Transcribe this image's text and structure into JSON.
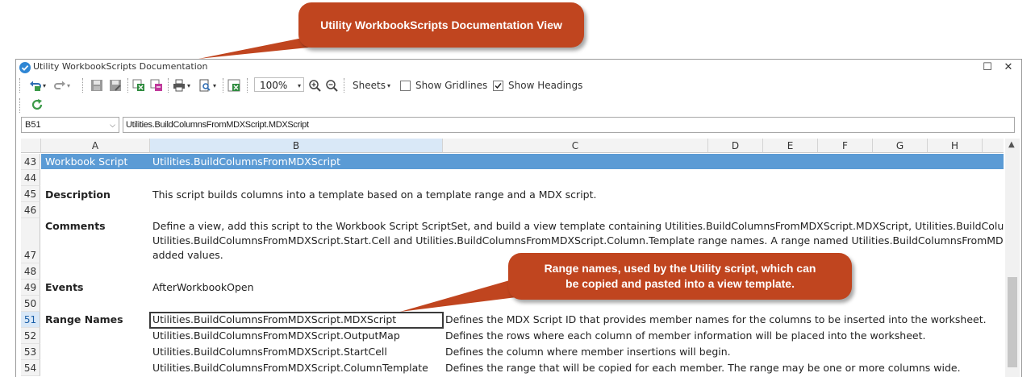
{
  "callouts": {
    "top": "Utility WorkbookScripts Documentation View",
    "range": "Range names, used by the Utility script, which can be copied and pasted into a view template."
  },
  "window": {
    "title": "Utility WorkbookScripts Documentation",
    "maximize": "☐",
    "close": "✕"
  },
  "toolbar": {
    "zoom": "100%",
    "sheets_label": "Sheets",
    "show_gridlines_label": "Show Gridlines",
    "show_gridlines_checked": false,
    "show_headings_label": "Show Headings",
    "show_headings_checked": true,
    "icons": [
      "undo-icon",
      "redo-icon",
      "save-icon",
      "save-as-icon",
      "export-excel-icon",
      "export-pdf-icon",
      "print-icon",
      "print-preview-icon",
      "excel-icon",
      "zoom-in-icon",
      "zoom-out-icon",
      "refresh-icon"
    ]
  },
  "formula_bar": {
    "name_box": "B51",
    "formula": "Utilities.BuildColumnsFromMDXScript.MDXScript"
  },
  "sheet": {
    "columns": [
      "A",
      "B",
      "C",
      "D",
      "E",
      "F",
      "G",
      "H"
    ],
    "selected_column": "B",
    "selected_row": "51",
    "rows": [
      {
        "num": "43",
        "a": "Workbook Script",
        "b": "Utilities.BuildColumnsFromMDXScript",
        "c": ""
      },
      {
        "num": "44",
        "a": "",
        "b": "",
        "c": ""
      },
      {
        "num": "45",
        "a": "Description",
        "b": "This script builds columns into a template based on a template range and a MDX script.",
        "c": ""
      },
      {
        "num": "46",
        "a": "",
        "b": "",
        "c": ""
      },
      {
        "num": "47",
        "a": "Comments",
        "b": "",
        "c": "",
        "lines": [
          "Define a view, add this script to the Workbook Script ScriptSet, and build a view template containing Utilities.BuildColumnsFromMDXScript.MDXScript, Utilities.BuildColumns",
          "Utilities.BuildColumnsFromMDXScript.Start.Cell and Utilities.BuildColumnsFromMDXScript.Column.Template range names.  A range named Utilities.BuildColumnsFromMDXS",
          "added values."
        ]
      },
      {
        "num": "48",
        "a": "",
        "b": "",
        "c": ""
      },
      {
        "num": "49",
        "a": "Events",
        "b": "AfterWorkbookOpen",
        "c": ""
      },
      {
        "num": "50",
        "a": "",
        "b": "",
        "c": ""
      },
      {
        "num": "51",
        "a": "Range Names",
        "b": "Utilities.BuildColumnsFromMDXScript.MDXScript",
        "c": "Defines the MDX Script ID that provides member names for the columns to be inserted into the worksheet."
      },
      {
        "num": "52",
        "a": "",
        "b": "Utilities.BuildColumnsFromMDXScript.OutputMap",
        "c": "Defines the rows where each column of member information will be placed into the worksheet."
      },
      {
        "num": "53",
        "a": "",
        "b": "Utilities.BuildColumnsFromMDXScript.StartCell",
        "c": "Defines the column where member insertions will begin."
      },
      {
        "num": "54",
        "a": "",
        "b": "Utilities.BuildColumnsFromMDXScript.ColumnTemplate",
        "c": "Defines the range that will be copied for each member.  The range may be one or more columns wide."
      }
    ]
  },
  "colors": {
    "callout": "#c0451f",
    "header_band": "#5b9bd5",
    "selection_header": "#d9e8f7"
  }
}
